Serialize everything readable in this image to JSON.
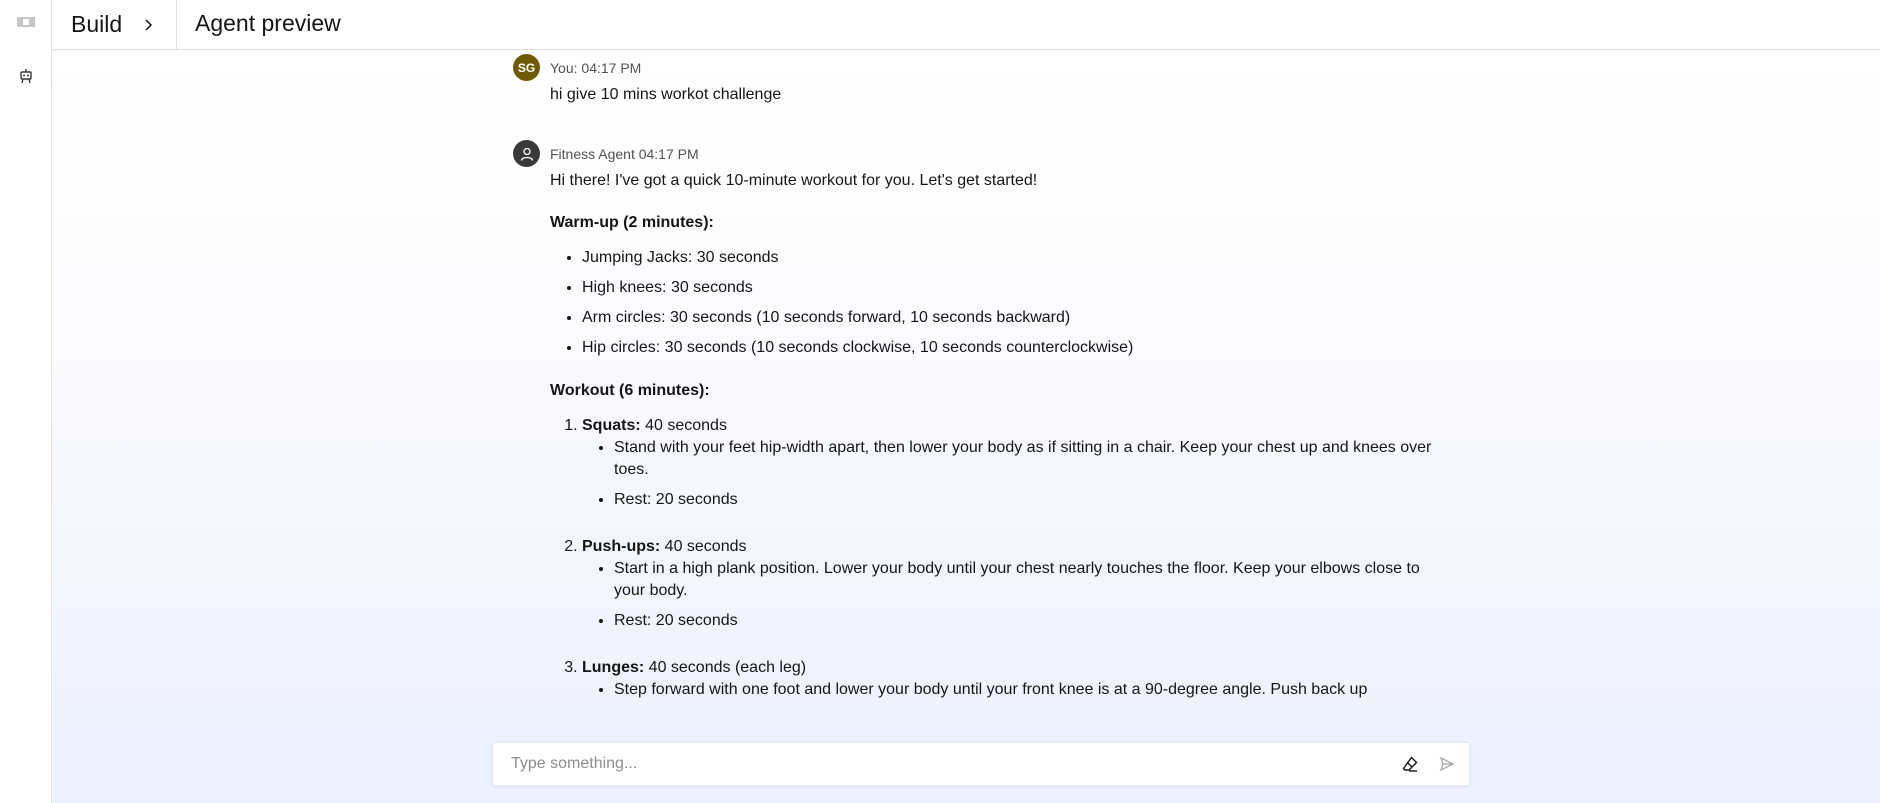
{
  "header": {
    "breadcrumb_root": "Build",
    "title": "Agent preview"
  },
  "rail": {
    "icons": [
      "collapse-panel-icon",
      "bot-icon"
    ]
  },
  "messages": [
    {
      "avatar_initials": "SG",
      "meta": "You: 04:17 PM",
      "text": "hi give 10 mins workot challenge"
    },
    {
      "meta": "Fitness Agent 04:17 PM",
      "intro": "Hi there! I've got a quick 10-minute workout for you. Let's get started!",
      "warmup_heading": "Warm-up (2 minutes):",
      "warmup_items": [
        "Jumping Jacks: 30 seconds",
        "High knees: 30 seconds",
        "Arm circles: 30 seconds (10 seconds forward, 10 seconds backward)",
        "Hip circles: 30 seconds (10 seconds clockwise, 10 seconds counterclockwise)"
      ],
      "workout_heading": "Workout (6 minutes):",
      "exercises": [
        {
          "name": "Squats:",
          "duration": " 40 seconds",
          "details": [
            "Stand with your feet hip-width apart, then lower your body as if sitting in a chair. Keep your chest up and knees over toes.",
            "Rest: 20 seconds"
          ]
        },
        {
          "name": "Push-ups:",
          "duration": " 40 seconds",
          "details": [
            "Start in a high plank position. Lower your body until your chest nearly touches the floor. Keep your elbows close to your body.",
            "Rest: 20 seconds"
          ]
        },
        {
          "name": "Lunges:",
          "duration": " 40 seconds (each leg)",
          "details": [
            "Step forward with one foot and lower your body until your front knee is at a 90-degree angle. Push back up"
          ]
        }
      ]
    }
  ],
  "composer": {
    "placeholder": "Type something...",
    "clear_icon": "eraser-icon",
    "send_icon": "send-icon"
  }
}
